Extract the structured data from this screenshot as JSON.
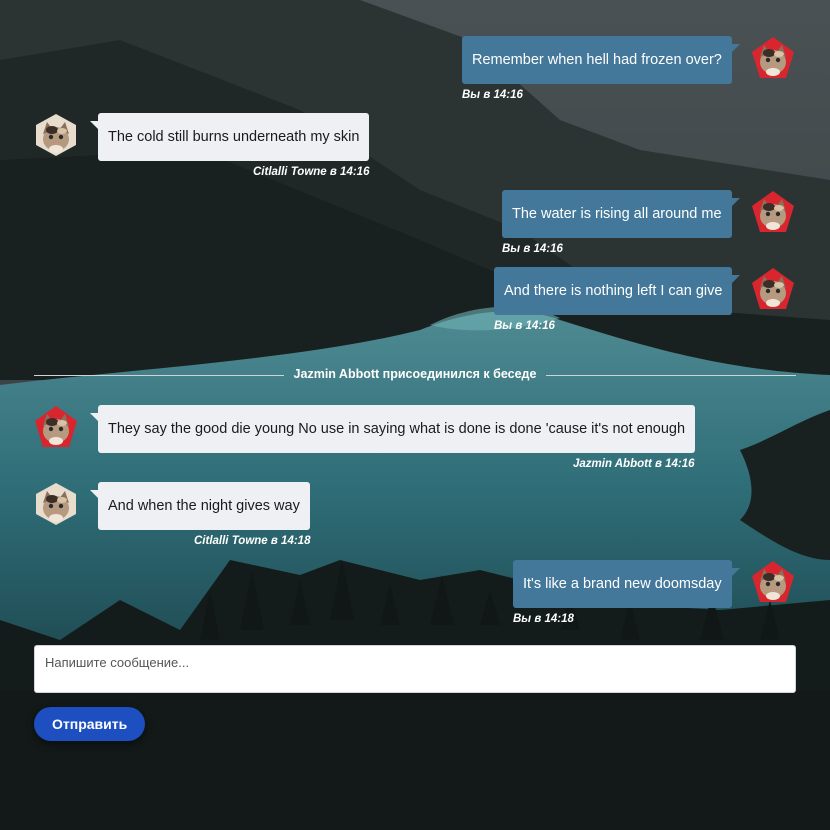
{
  "messages": [
    {
      "id": "m1",
      "side": "out",
      "text": "Remember when hell had frozen over?",
      "author": "Вы",
      "time": "14:16",
      "avatar": "pentagon-cat-avatar"
    },
    {
      "id": "m2",
      "side": "in",
      "text": "The cold still burns underneath my skin",
      "author": "Citlalli Towne",
      "time": "14:16",
      "avatar": "hexagon-cat-avatar"
    },
    {
      "id": "m3",
      "side": "out",
      "text": "The water is rising all around me",
      "author": "Вы",
      "time": "14:16",
      "avatar": "pentagon-cat-avatar"
    },
    {
      "id": "m4",
      "side": "out",
      "text": "And there is nothing left I can give",
      "author": "Вы",
      "time": "14:16",
      "avatar": "pentagon-cat-avatar"
    },
    {
      "id": "m5",
      "side": "in",
      "text": "They say the good die young No use in saying what is done is done 'cause it's not enough",
      "author": "Jazmin Abbott",
      "time": "14:16",
      "avatar": "pentagon-cat-avatar"
    },
    {
      "id": "m6",
      "side": "in",
      "text": "And when the night gives way",
      "author": "Citlalli Towne",
      "time": "14:18",
      "avatar": "hexagon-cat-avatar"
    },
    {
      "id": "m7",
      "side": "out",
      "text": "It's like a brand new doomsday",
      "author": "Вы",
      "time": "14:18",
      "avatar": "pentagon-cat-avatar"
    }
  ],
  "time_separator": "в",
  "system_event": "Jazmin Abbott присоединился к беседе",
  "composer": {
    "placeholder": "Напишите сообщение...",
    "value": ""
  },
  "send_button": "Отправить",
  "colors": {
    "outgoing_bubble": "#43789a",
    "incoming_bubble": "#eef0f3",
    "send_button": "#1d4fc1",
    "avatar_pentagon": "#d9262e"
  }
}
